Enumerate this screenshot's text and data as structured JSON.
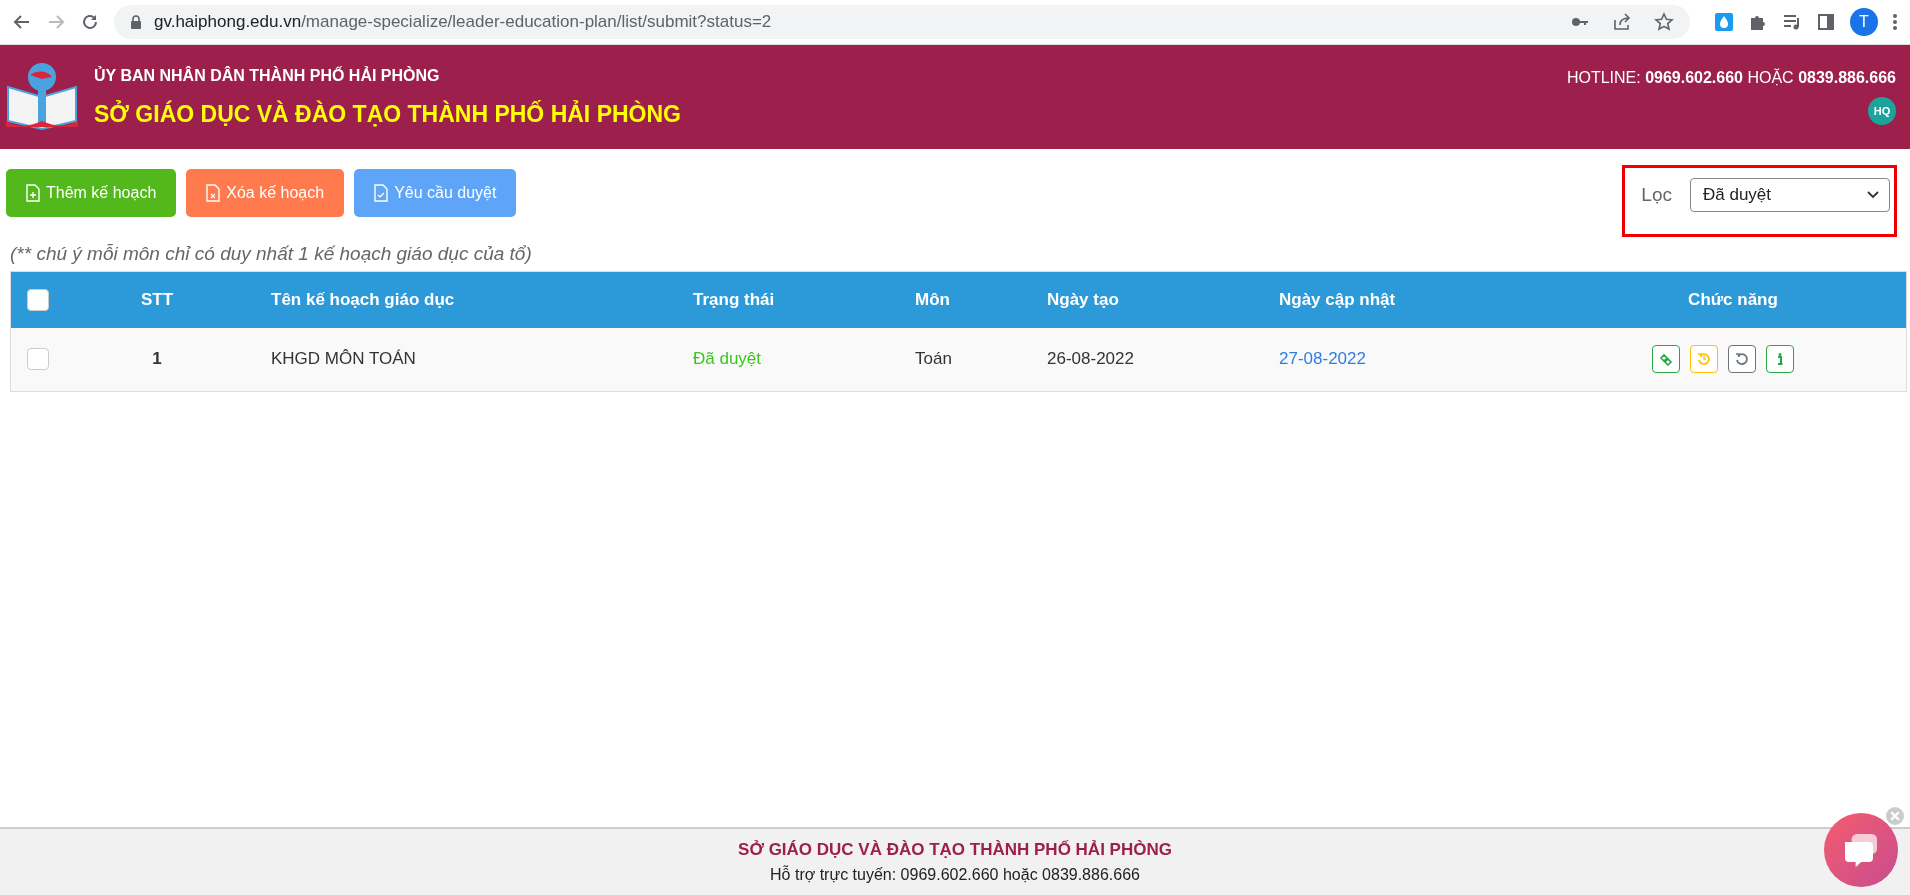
{
  "browser": {
    "url_host": "gv.haiphong.edu.vn",
    "url_path": "/manage-specialize/leader-education-plan/list/submit?status=2",
    "profile": "T"
  },
  "header": {
    "line1": "ỦY BAN NHÂN DÂN THÀNH PHỐ HẢI PHÒNG",
    "line2": "SỞ GIÁO DỤC VÀ ĐÀO TẠO THÀNH PHỐ HẢI PHÒNG",
    "hotline": "HOTLINE: **0969.602.660** HOẶC **0839.886.666**",
    "avatar": "HQ"
  },
  "toolbar": {
    "buttons": [
      {
        "label": "Thêm kế hoạch",
        "kind": "add"
      },
      {
        "label": "Xóa kế hoạch",
        "kind": "delete"
      },
      {
        "label": "Yêu cầu duyệt",
        "kind": "request"
      }
    ],
    "filter": {
      "label": "Lọc",
      "value": "Đã duyệt",
      "highlighted": true
    }
  },
  "note": "(** chú ý mỗi môn chỉ có duy nhất 1 kế hoạch giáo dục của tổ)",
  "table": {
    "select_all_checked": false,
    "columns": [
      "STT",
      "Tên kế hoạch giáo dục",
      "Trạng thái",
      "Môn",
      "Ngày tạo",
      "Ngày cập nhật",
      "Chức năng"
    ],
    "rows": [
      {
        "checked": false,
        "stt": "1",
        "name": "KHGD MÔN TOÁN",
        "status": "Đã duyệt",
        "color": "#3cc51d",
        "subject": "Toán",
        "created": "26-08-2022",
        "updated": "27-08-2022",
        "actions": [
          {
            "kind": "link",
            "color": "#28a745"
          },
          {
            "kind": "restore",
            "color": "#ffc107"
          },
          {
            "kind": "undo",
            "color": "#6c757d"
          },
          {
            "kind": "info",
            "color": "#28a745"
          }
        ]
      }
    ]
  },
  "footer": {
    "title": "SỞ GIÁO DỤC VÀ ĐÀO TẠO THÀNH PHỐ HẢI PHÒNG",
    "support": "Hỗ trợ trực tuyến: 0969.602.660 hoặc 0839.886.666"
  }
}
